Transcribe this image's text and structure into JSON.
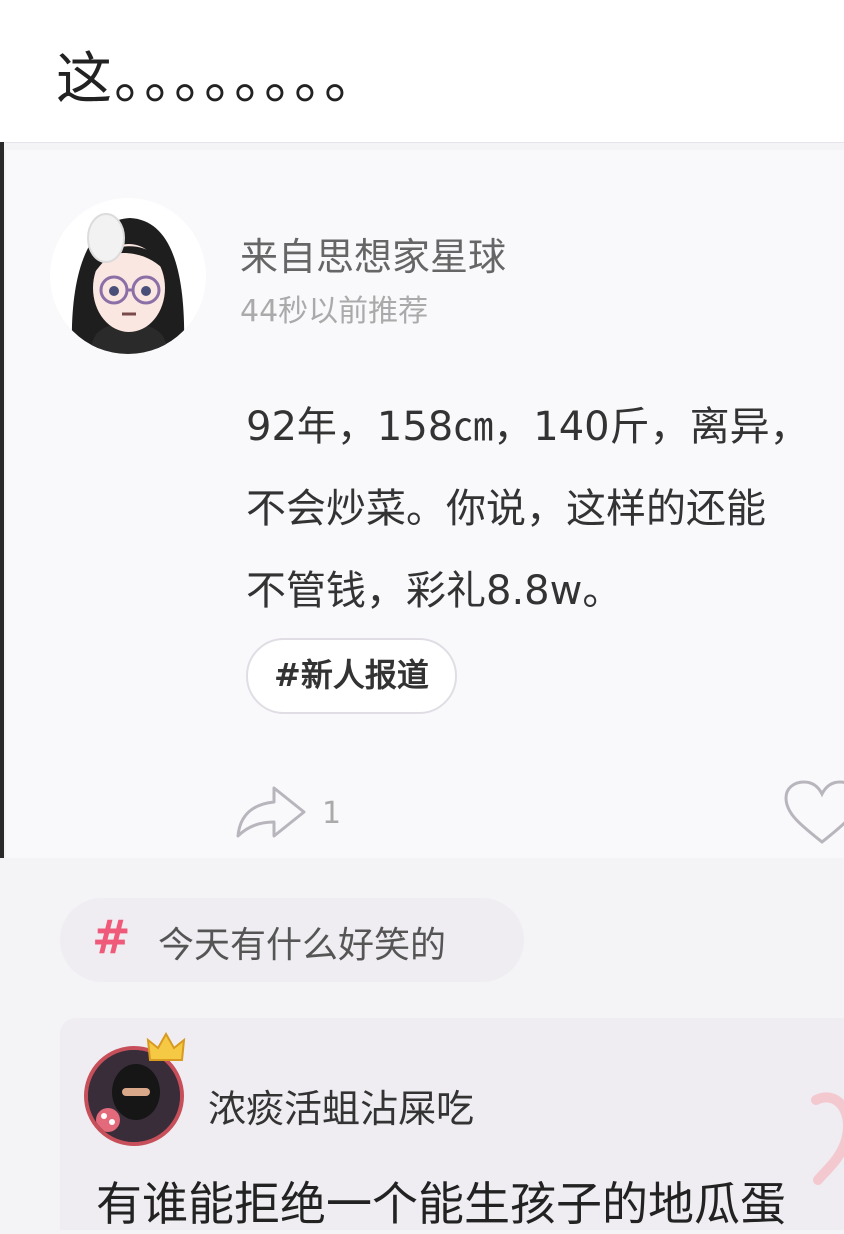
{
  "top_post": {
    "text": "这。。。。。。。。"
  },
  "post": {
    "username": "来自思想家星球",
    "time": "44秒以前推荐",
    "lines": [
      "92年，158㎝，140斤，离异，",
      "不会炒菜。你说，这样的还能",
      "不管钱，彩礼8.8w。"
    ],
    "tag": "#新人报道",
    "share_count": "1",
    "icons": {
      "share": "share-icon",
      "like": "heart-icon"
    }
  },
  "topic": {
    "hash": "#",
    "label": "今天有什么好笑的"
  },
  "next_post": {
    "username": "浓痰活蛆沾屎吃",
    "text": "有谁能拒绝一个能生孩子的地瓜蛋"
  },
  "colors": {
    "accent": "#ef5a7a",
    "background": "#f4f3f6"
  }
}
